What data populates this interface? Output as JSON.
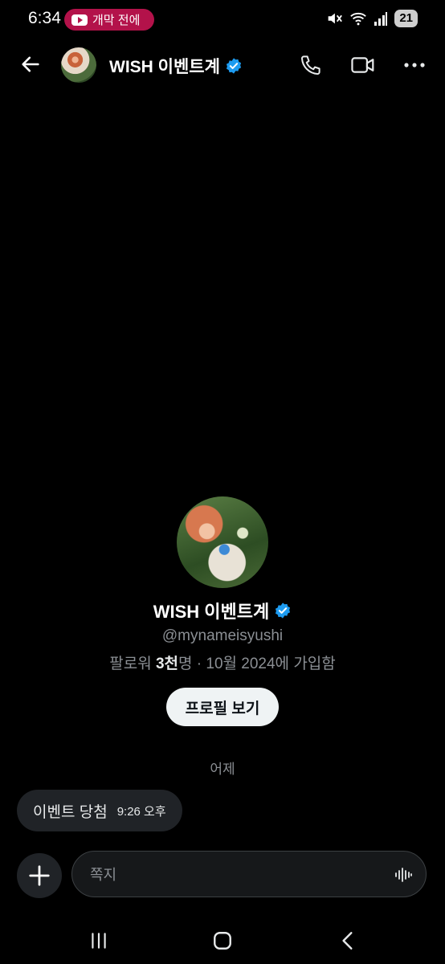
{
  "status_bar": {
    "time": "6:34",
    "youtube_pill": "개막 전에 ",
    "battery": "21",
    "accent_color": "#b3124a"
  },
  "header": {
    "title": "WISH 이벤트계",
    "icons": [
      "back-arrow-icon",
      "phone-icon",
      "video-icon",
      "more-icon"
    ]
  },
  "profile": {
    "name": "WISH 이벤트계",
    "handle": "@mynameisyushi",
    "followers_prefix": "팔로워 ",
    "followers_count": "3천",
    "followers_suffix": "명 · 10월 2024에 가입함",
    "view_profile_label": "프로필 보기",
    "verified_color": "#1d9bf0"
  },
  "conversation": {
    "date_separator": "어제",
    "messages": [
      {
        "text": "이벤트 당첨",
        "time": "9:26 오후"
      }
    ]
  },
  "composer": {
    "placeholder": "쪽지"
  },
  "nav": {
    "icons": [
      "recent-apps-icon",
      "home-icon",
      "back-icon"
    ]
  }
}
